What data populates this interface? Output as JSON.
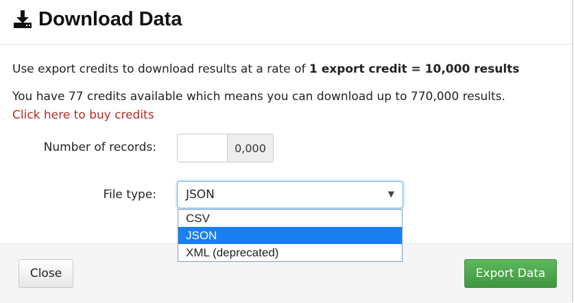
{
  "header": {
    "title": "Download Data",
    "icon": "download-icon"
  },
  "body": {
    "rate_text_prefix": "Use export credits to download results at a rate of ",
    "rate_text_bold": "1 export credit = 10,000 results",
    "credits_text": "You have 77 credits available which means you can download up to 770,000 results.",
    "buy_link": "Click here to buy credits",
    "records_label": "Number of records:",
    "records_value": "",
    "records_suffix": "0,000",
    "filetype_label": "File type:",
    "filetype_selected": "JSON",
    "filetype_arrow": "▼"
  },
  "dropdown": {
    "options": [
      "CSV",
      "JSON",
      "XML (deprecated)"
    ],
    "highlighted": "JSON"
  },
  "footer": {
    "close_label": "Close",
    "export_label": "Export Data"
  },
  "colors": {
    "link": "#b52b27",
    "export_button": "#4cae4c",
    "highlight": "#1a7ff0"
  }
}
